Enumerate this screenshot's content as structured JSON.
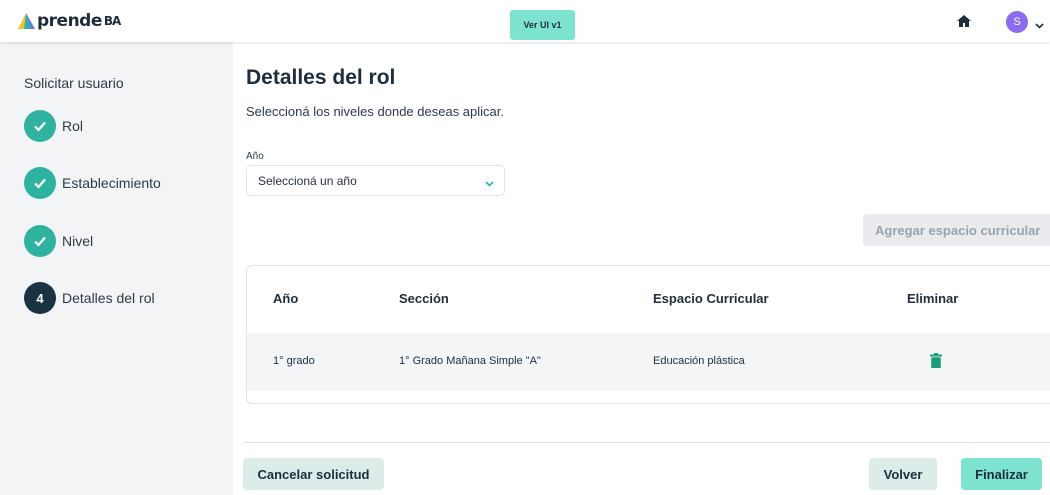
{
  "header": {
    "logo_text": "prende",
    "logo_suffix": "BA",
    "version_button": "Ver UI v1",
    "home_icon": "home-icon",
    "avatar_initial": "S",
    "brand_color": "#7de3cf"
  },
  "sidebar": {
    "title": "Solicitar usuario",
    "steps": [
      {
        "label": "Rol",
        "state": "completed",
        "icon": "check-icon"
      },
      {
        "label": "Establecimiento",
        "state": "completed",
        "icon": "check-icon"
      },
      {
        "label": "Nivel",
        "state": "completed",
        "icon": "check-icon"
      },
      {
        "number": "4",
        "label": "Detalles del rol",
        "state": "active"
      }
    ],
    "completed_color": "#2fb3a0",
    "active_color": "#1a3343"
  },
  "main": {
    "title": "Detalles del rol",
    "subtitle": "Seleccioná los niveles donde deseas aplicar.",
    "year_field": {
      "label": "Año",
      "placeholder": "Seleccioná un año"
    },
    "add_button": "Agregar espacio curricular",
    "table": {
      "headers": [
        "Año",
        "Sección",
        "Espacio Curricular",
        "Eliminar"
      ],
      "rows": [
        {
          "year": "1° grado",
          "section": "1° Grado Mañana Simple \"A\"",
          "subject": "Educación plástica",
          "delete_icon": "trash-icon"
        }
      ]
    }
  },
  "footer": {
    "cancel_button": "Cancelar solicitud",
    "back_button": "Volver",
    "finish_button": "Finalizar"
  }
}
